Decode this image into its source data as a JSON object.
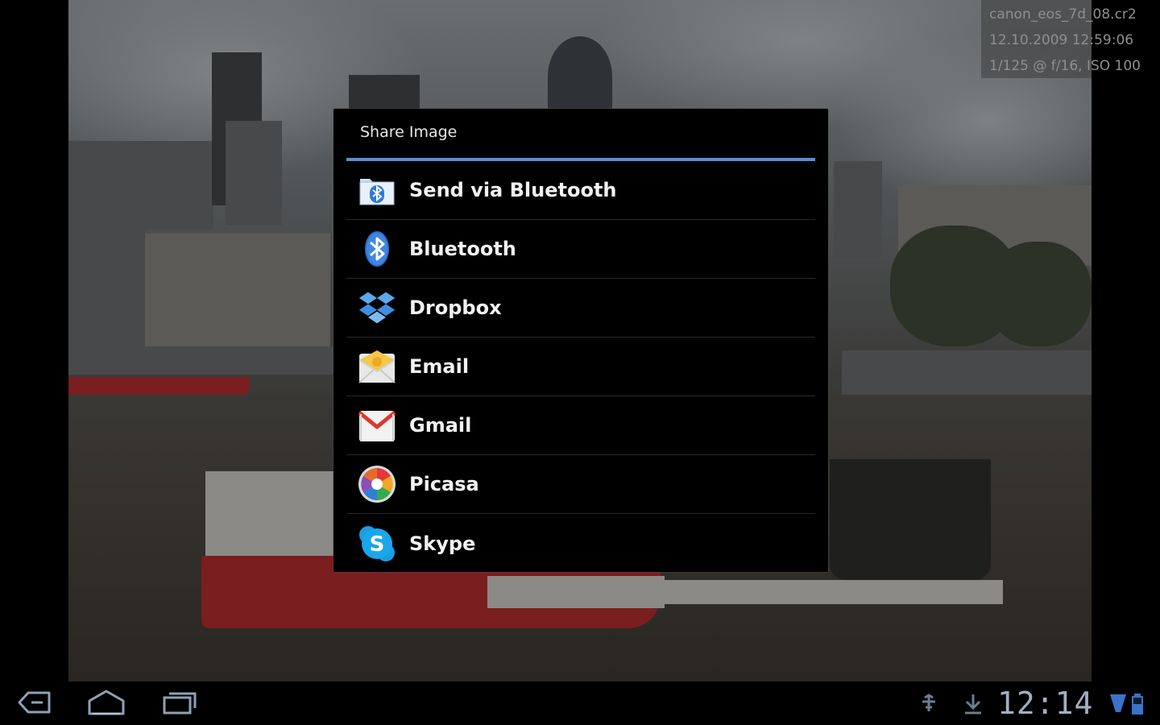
{
  "photo_info": {
    "filename": "canon_eos_7d_08.cr2",
    "datetime": "12.10.2009 12:59:06",
    "exposure": "1/125 @ f/16, ISO 100"
  },
  "dialog": {
    "title": "Share Image",
    "items": [
      {
        "label": "Send via Bluetooth",
        "icon": "bluetooth-file-icon"
      },
      {
        "label": "Bluetooth",
        "icon": "bluetooth-icon"
      },
      {
        "label": "Dropbox",
        "icon": "dropbox-icon"
      },
      {
        "label": "Email",
        "icon": "email-icon"
      },
      {
        "label": "Gmail",
        "icon": "gmail-icon"
      },
      {
        "label": "Picasa",
        "icon": "picasa-icon"
      },
      {
        "label": "Skype",
        "icon": "skype-icon"
      }
    ],
    "accent_color": "#5a8ed6"
  },
  "system_bar": {
    "back": "back-icon",
    "home": "home-icon",
    "recent": "recent-apps-icon",
    "time": "12:14",
    "status_icons": [
      "usb-debug-icon",
      "download-icon",
      "wifi-icon",
      "battery-icon"
    ]
  }
}
